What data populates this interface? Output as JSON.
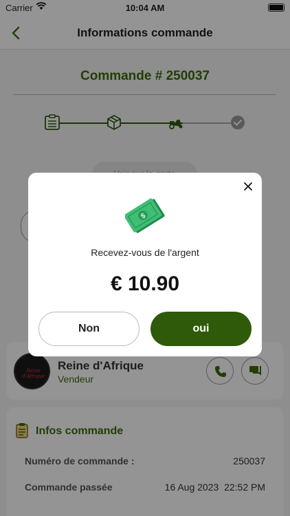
{
  "status_bar": {
    "carrier": "Carrier",
    "time": "10:04 AM"
  },
  "nav": {
    "title": "Informations commande"
  },
  "order": {
    "title": "Commande # 250037",
    "see_button": "Voir sur la carte",
    "steps": [
      "order-list-icon",
      "package-icon",
      "delivery-scooter-icon",
      "check-circle-icon"
    ],
    "completed_steps": 3
  },
  "vendor": {
    "name": "Reine d'Afrique",
    "role": "Vendeur",
    "logo_text": "Reine d'Afrique"
  },
  "info": {
    "heading": "Infos commande",
    "rows": [
      {
        "label": "Numéro de commande :",
        "value": "250037"
      },
      {
        "label": "Commande passée",
        "value": "16 Aug 2023  22:52 PM"
      }
    ]
  },
  "modal": {
    "question": "Recevez-vous de l'argent",
    "amount": "€ 10.90",
    "no_label": "Non",
    "yes_label": "oui",
    "icon": "money-icon"
  },
  "colors": {
    "accent": "#3b6b0c",
    "primary_button": "#2e5a0a"
  }
}
